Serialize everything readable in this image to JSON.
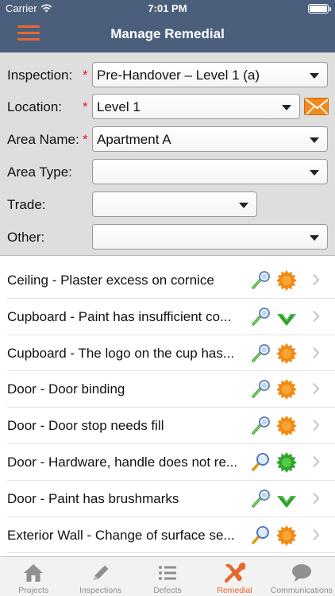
{
  "status_bar": {
    "carrier": "Carrier",
    "time": "7:01 PM"
  },
  "nav": {
    "title": "Manage Remedial",
    "accent_color": "#e8672c",
    "bar_color": "#4b5f7d"
  },
  "filters": {
    "inspection": {
      "label": "Inspection:",
      "required": "*",
      "value": "Pre-Handover – Level 1 (a)"
    },
    "location": {
      "label": "Location:",
      "required": "*",
      "value": "Level 1"
    },
    "area_name": {
      "label": "Area Name:",
      "required": "*",
      "value": "Apartment A"
    },
    "area_type": {
      "label": "Area Type:",
      "value": ""
    },
    "trade": {
      "label": "Trade:",
      "value": ""
    },
    "other": {
      "label": "Other:",
      "value": ""
    }
  },
  "remedials": [
    {
      "text": "Ceiling - Plaster excess on cornice",
      "tool_icon": "wand-icon",
      "status_icon": "orange-burst-icon"
    },
    {
      "text": "Cupboard - Paint has insufficient co...",
      "tool_icon": "wand-icon",
      "status_icon": "green-check-icon"
    },
    {
      "text": "Cupboard - The logo on the cup has...",
      "tool_icon": "wand-icon",
      "status_icon": "orange-burst-icon"
    },
    {
      "text": "Door - Door binding",
      "tool_icon": "wand-icon",
      "status_icon": "orange-burst-icon"
    },
    {
      "text": "Door - Door stop needs fill",
      "tool_icon": "wand-icon",
      "status_icon": "orange-burst-icon"
    },
    {
      "text": "Door - Hardware, handle does not re...",
      "tool_icon": "magnifier-icon",
      "status_icon": "green-burst-icon"
    },
    {
      "text": "Door - Paint has brushmarks",
      "tool_icon": "wand-icon",
      "status_icon": "green-check-icon"
    },
    {
      "text": "Exterior Wall - Change of surface se...",
      "tool_icon": "magnifier-icon",
      "status_icon": "orange-burst-icon"
    }
  ],
  "tabs": [
    {
      "label": "Projects",
      "icon": "home-icon",
      "active": false
    },
    {
      "label": "Inspections",
      "icon": "pencil-icon",
      "active": false
    },
    {
      "label": "Defects",
      "icon": "list-icon",
      "active": false
    },
    {
      "label": "Remedial",
      "icon": "tools-icon",
      "active": true
    },
    {
      "label": "Communications",
      "icon": "chat-icon",
      "active": false
    }
  ]
}
